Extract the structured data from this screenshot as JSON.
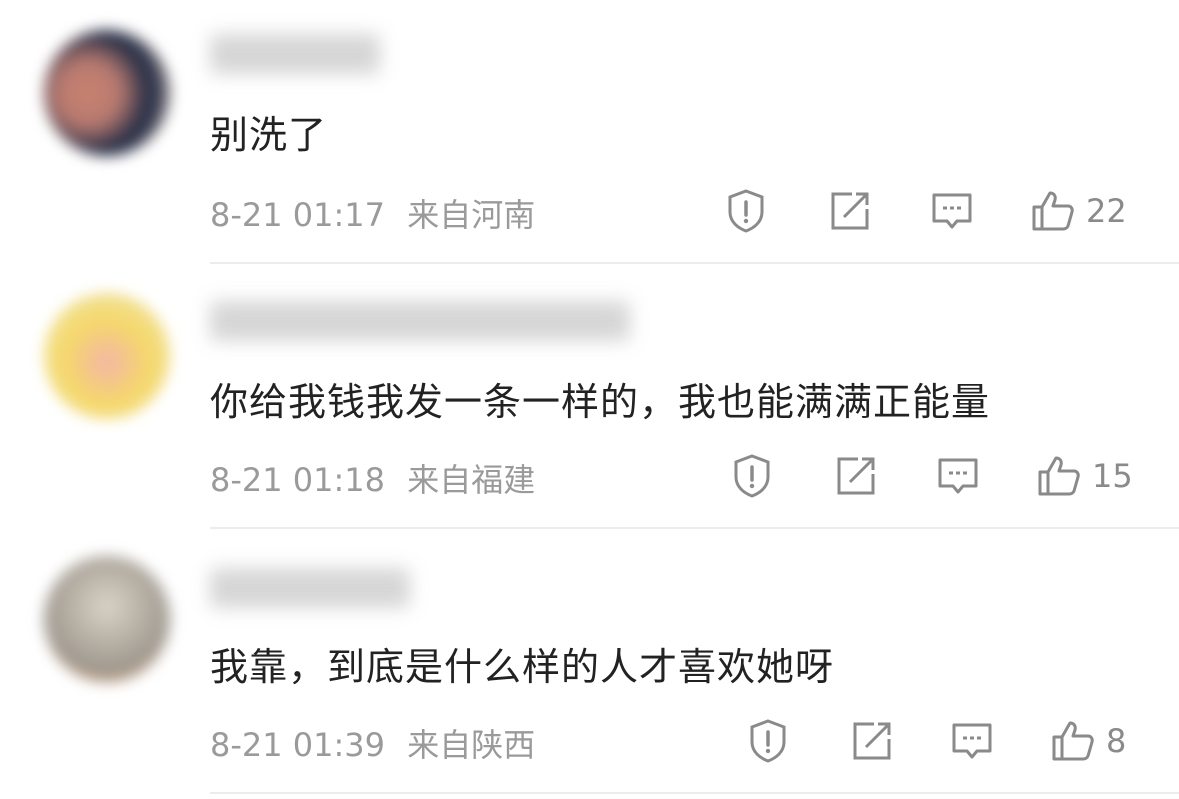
{
  "comments": [
    {
      "text": "别洗了",
      "time": "8-21 01:17",
      "location": "来自河南",
      "likes": "22",
      "avatar_colors": [
        "#1f2a44",
        "#c9826f",
        "#e8c9b8"
      ]
    },
    {
      "text": "你给我钱我发一条一样的，我也能满满正能量",
      "time": "8-21 01:18",
      "location": "来自福建",
      "likes": "15",
      "avatar_colors": [
        "#f5d86a",
        "#f3b6a7",
        "#89b6e6"
      ]
    },
    {
      "text": "我靠，到底是什么样的人才喜欢她呀",
      "time": "8-21 01:39",
      "location": "来自陕西",
      "likes": "8",
      "avatar_colors": [
        "#9f9990",
        "#d9d3c8",
        "#e3873f"
      ]
    }
  ],
  "icons": {
    "report": "report-icon",
    "repost": "repost-icon",
    "reply": "reply-icon",
    "like": "like-icon"
  },
  "colors": {
    "text": "#222222",
    "meta": "#9a9a9a",
    "icon": "#8a8a8a",
    "divider": "#ececec"
  }
}
